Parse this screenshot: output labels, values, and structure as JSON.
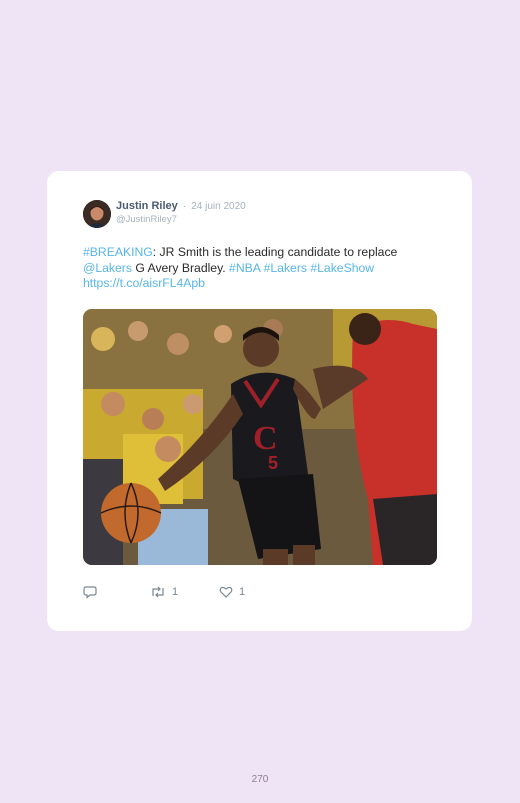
{
  "tweet": {
    "author_name": "Justin Riley",
    "separator": "·",
    "date": "24 juin 2020",
    "handle": "@JustinRiley7",
    "text": {
      "hashtag_breaking": "#BREAKING",
      "line1": ": JR Smith is the leading candidate to replace",
      "mention_lakers": "@Lakers",
      "line2": " G Avery Bradley. ",
      "hashtag_nba": "#NBA",
      "hashtag_lakers": "#Lakers",
      "hashtag_lakeshow": "#LakeShow",
      "url": "https://t.co/aisrFL4Apb"
    },
    "actions": {
      "reply_count": "",
      "retweet_count": "1",
      "like_count": "1"
    }
  },
  "page_number": "270",
  "colors": {
    "background": "#efe4f5",
    "link": "#57b6e9",
    "card": "#ffffff"
  },
  "icons": [
    "reply-icon",
    "retweet-icon",
    "like-icon"
  ]
}
